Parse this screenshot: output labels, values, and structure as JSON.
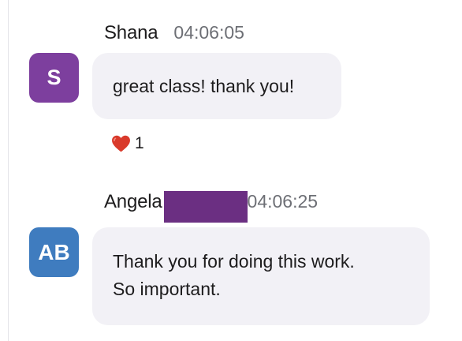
{
  "messages": [
    {
      "sender": "Shana",
      "time": "04:06:05",
      "avatar": {
        "initials": "S",
        "color": "#7d3f9e"
      },
      "lines": [
        "great class! thank you!"
      ],
      "reaction": {
        "icon": "heart",
        "color": "#d93a2b",
        "count": "1"
      }
    },
    {
      "sender": "Angela",
      "redaction_color": "#6b2f82",
      "time": "04:06:25",
      "avatar": {
        "initials": "AB",
        "color": "#3f7cbf"
      },
      "lines": [
        "Thank you for doing this work.",
        "So important."
      ]
    }
  ]
}
